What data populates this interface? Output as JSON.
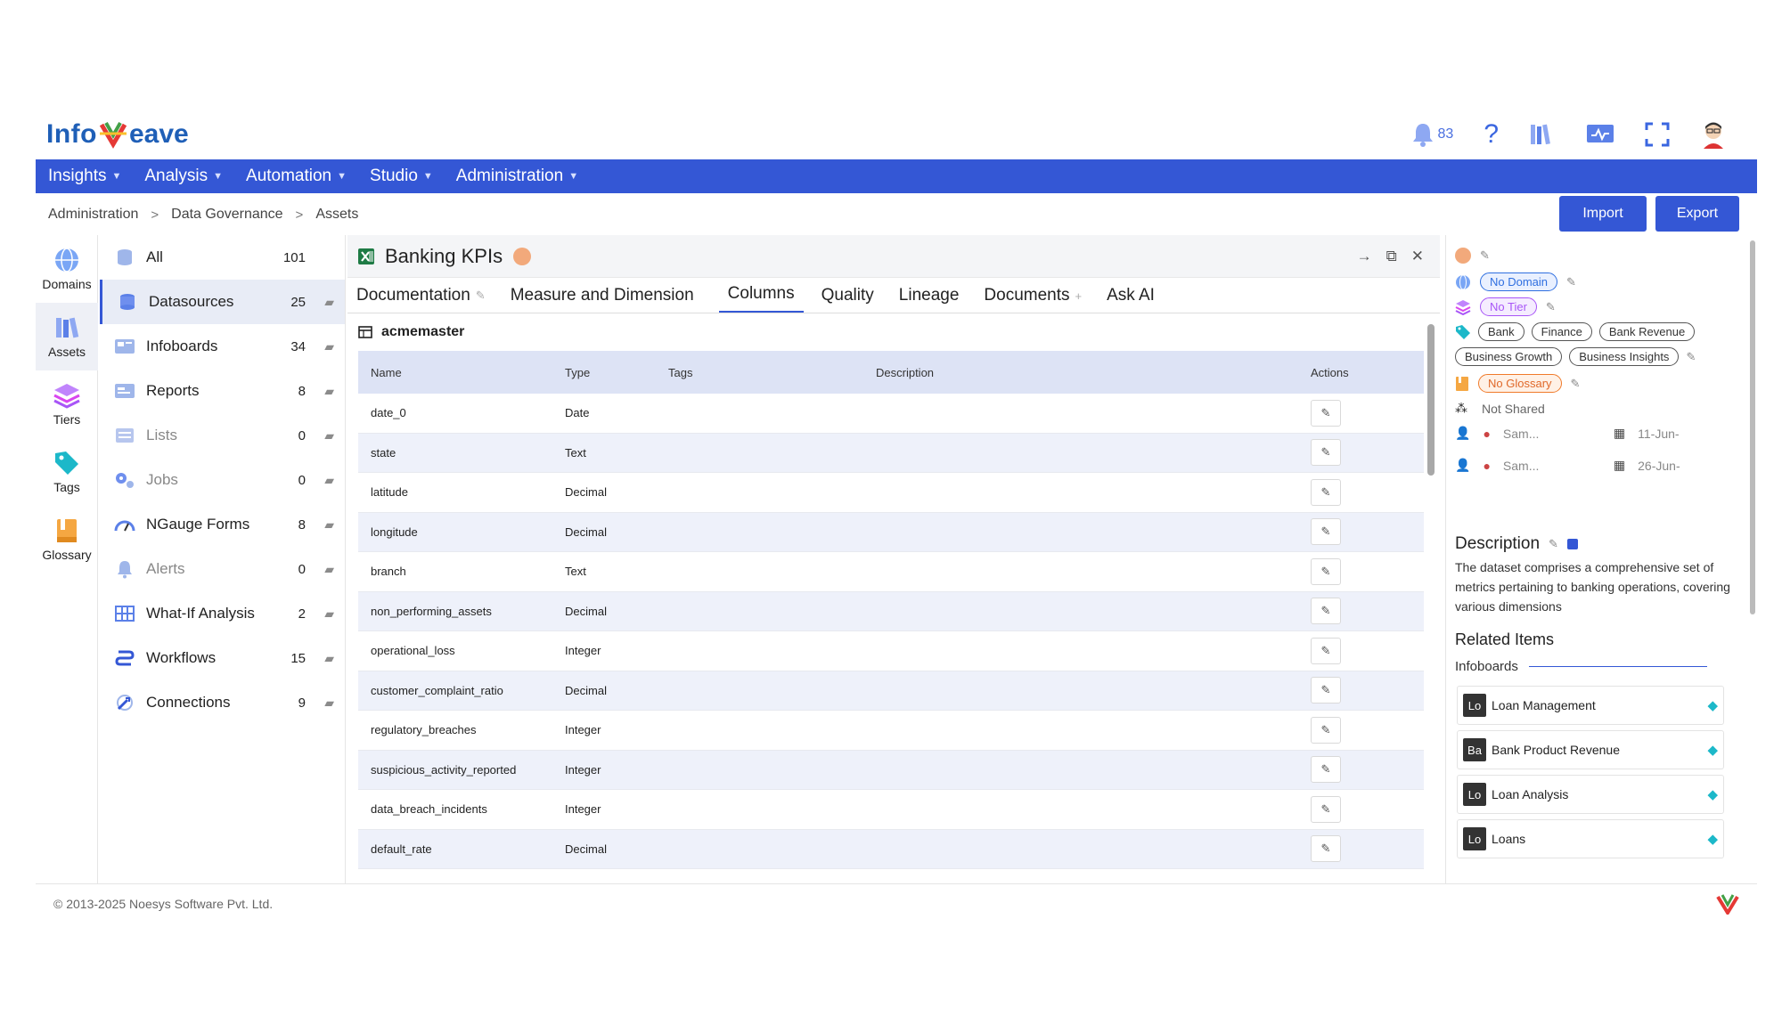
{
  "brand": {
    "logo_left": "Info",
    "logo_right": "eave"
  },
  "header": {
    "notification_count": "83"
  },
  "nav": [
    "Insights",
    "Analysis",
    "Automation",
    "Studio",
    "Administration"
  ],
  "breadcrumb": [
    "Administration",
    "Data Governance",
    "Assets"
  ],
  "actions": {
    "import": "Import",
    "export": "Export"
  },
  "rail": [
    {
      "label": "Domains",
      "icon": "globe-icon"
    },
    {
      "label": "Assets",
      "icon": "books-icon"
    },
    {
      "label": "Tiers",
      "icon": "layers-icon"
    },
    {
      "label": "Tags",
      "icon": "tag-icon"
    },
    {
      "label": "Glossary",
      "icon": "book-icon"
    }
  ],
  "categories": [
    {
      "label": "All",
      "count": "101",
      "icon": "database-icon"
    },
    {
      "label": "Datasources",
      "count": "25",
      "icon": "database-icon"
    },
    {
      "label": "Infoboards",
      "count": "34",
      "icon": "dashboard-icon"
    },
    {
      "label": "Reports",
      "count": "8",
      "icon": "report-icon"
    },
    {
      "label": "Lists",
      "count": "0",
      "icon": "list-icon"
    },
    {
      "label": "Jobs",
      "count": "0",
      "icon": "gears-icon"
    },
    {
      "label": "NGauge Forms",
      "count": "8",
      "icon": "gauge-icon"
    },
    {
      "label": "Alerts",
      "count": "0",
      "icon": "bell-icon"
    },
    {
      "label": "What-If Analysis",
      "count": "2",
      "icon": "grid-icon"
    },
    {
      "label": "Workflows",
      "count": "15",
      "icon": "workflow-icon"
    },
    {
      "label": "Connections",
      "count": "9",
      "icon": "connection-icon"
    }
  ],
  "asset": {
    "title": "Banking KPIs",
    "table_name": "acmemaster"
  },
  "tabs": [
    "Documentation",
    "Measure and Dimension",
    "Columns",
    "Quality",
    "Lineage",
    "Documents",
    "Ask AI"
  ],
  "columns_table": {
    "headers": [
      "Name",
      "Type",
      "Tags",
      "Description",
      "Actions"
    ],
    "rows": [
      {
        "name": "date_0",
        "type": "Date"
      },
      {
        "name": "state",
        "type": "Text"
      },
      {
        "name": "latitude",
        "type": "Decimal"
      },
      {
        "name": "longitude",
        "type": "Decimal"
      },
      {
        "name": "branch",
        "type": "Text"
      },
      {
        "name": "non_performing_assets",
        "type": "Decimal"
      },
      {
        "name": "operational_loss",
        "type": "Integer"
      },
      {
        "name": "customer_complaint_ratio",
        "type": "Decimal"
      },
      {
        "name": "regulatory_breaches",
        "type": "Integer"
      },
      {
        "name": "suspicious_activity_reported",
        "type": "Integer"
      },
      {
        "name": "data_breach_incidents",
        "type": "Integer"
      },
      {
        "name": "default_rate",
        "type": "Decimal"
      }
    ]
  },
  "details": {
    "domain": "No Domain",
    "tier": "No Tier",
    "tags": [
      "Bank",
      "Finance",
      "Bank Revenue",
      "Business Growth",
      "Business Insights"
    ],
    "glossary": "No Glossary",
    "sharing": "Not Shared",
    "created_by": "Sam...",
    "created_date": "11-Jun-",
    "modified_by": "Sam...",
    "modified_date": "26-Jun-",
    "description_title": "Description",
    "description": "The dataset comprises a comprehensive set of metrics pertaining to banking operations, covering various dimensions",
    "related_title": "Related Items",
    "infoboards_title": "Infoboards",
    "infoboards": [
      {
        "badge": "Lo",
        "name": "Loan Management"
      },
      {
        "badge": "Ba",
        "name": "Bank Product Revenue"
      },
      {
        "badge": "Lo",
        "name": "Loan Analysis"
      },
      {
        "badge": "Lo",
        "name": "Loans"
      }
    ]
  },
  "footer": {
    "copyright": "© 2013-2025 Noesys Software Pvt. Ltd."
  },
  "colors": {
    "primary": "#3457d5",
    "nav": "#3457d5",
    "row_alt": "#eef1fa",
    "header_row": "#dde3f5"
  }
}
